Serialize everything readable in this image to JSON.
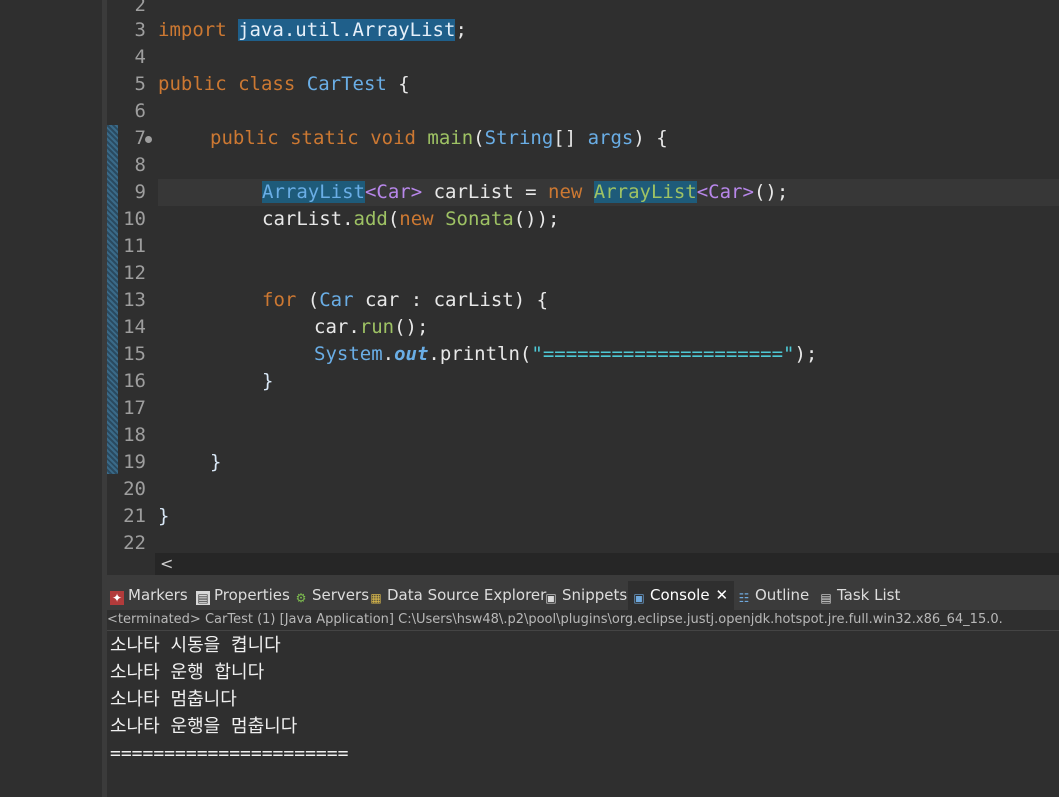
{
  "editor": {
    "line_numbers": [
      "2",
      "3",
      "4",
      "5",
      "6",
      "7",
      "8",
      "9",
      "10",
      "11",
      "12",
      "13",
      "14",
      "15",
      "16",
      "17",
      "18",
      "19",
      "20",
      "21",
      "22"
    ]
  },
  "code": {
    "l3_import": "import",
    "l3_pkg": "java.util.ArrayList",
    "l3_semi": ";",
    "l5_public": "public",
    "l5_class": "class",
    "l5_name": "CarTest",
    "l5_brace": "{",
    "l7_public": "public",
    "l7_static": "static",
    "l7_void": "void",
    "l7_main": "main",
    "l7_open": "(",
    "l7_string": "String",
    "l7_arr": "[]",
    "l7_args": "args",
    "l7_close": ") {",
    "l9_type": "ArrayList",
    "l9_gen": "<Car>",
    "l9_var": " carList = ",
    "l9_new": "new",
    "l9_type2": "ArrayList",
    "l9_gen2": "<Car>",
    "l9_end": "();",
    "l10_a": "carList.",
    "l10_add": "add",
    "l10_b": "(",
    "l10_new": "new",
    "l10_sonata": "Sonata",
    "l10_end": "());",
    "l13_for": "for",
    "l13_open": " (",
    "l13_car": "Car",
    "l13_rest": " car : carList) {",
    "l14_a": "car.",
    "l14_run": "run",
    "l14_end": "();",
    "l15_sys": "System",
    "l15_dot": ".",
    "l15_out": "out",
    "l15_println": ".println(",
    "l15_str": "\"=====================\"",
    "l15_end": ");",
    "l16": "}",
    "l19": "}",
    "l21": "}"
  },
  "scrollbar": {
    "left_arrow": "<"
  },
  "tabs": {
    "markers": "Markers",
    "properties": "Properties",
    "servers": "Servers",
    "datasource": "Data Source Explorer",
    "snippets": "Snippets",
    "console": "Console",
    "outline": "Outline",
    "tasklist": "Task List",
    "close_glyph": "✕"
  },
  "console": {
    "status": "<terminated> CarTest (1) [Java Application] C:\\Users\\hsw48\\.p2\\pool\\plugins\\org.eclipse.justj.openjdk.hotspot.jre.full.win32.x86_64_15.0.",
    "lines": [
      "소나타 시동을 켭니다",
      "소나타 운행 합니다",
      "소나타 멈춥니다",
      "소나타 운행을 멈춥니다",
      "======================"
    ]
  }
}
